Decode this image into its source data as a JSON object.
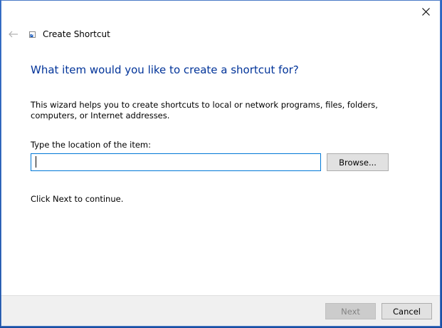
{
  "window": {
    "title": "Create Shortcut"
  },
  "icons": {
    "close": "close-icon",
    "back": "back-arrow-icon",
    "app": "shortcut-icon"
  },
  "content": {
    "main_instruction": "What item would you like to create a shortcut for?",
    "description": "This wizard helps you to create shortcuts to local or network programs, files, folders, computers, or Internet addresses.",
    "location_label": "Type the location of the item:",
    "location_value": "",
    "browse_label": "Browse...",
    "continue_text": "Click Next to continue."
  },
  "footer": {
    "next_label": "Next",
    "next_enabled": false,
    "cancel_label": "Cancel"
  },
  "colors": {
    "instruction": "#003399",
    "input_border_focus": "#0078d7",
    "footer_bg": "#f0f0f0"
  }
}
